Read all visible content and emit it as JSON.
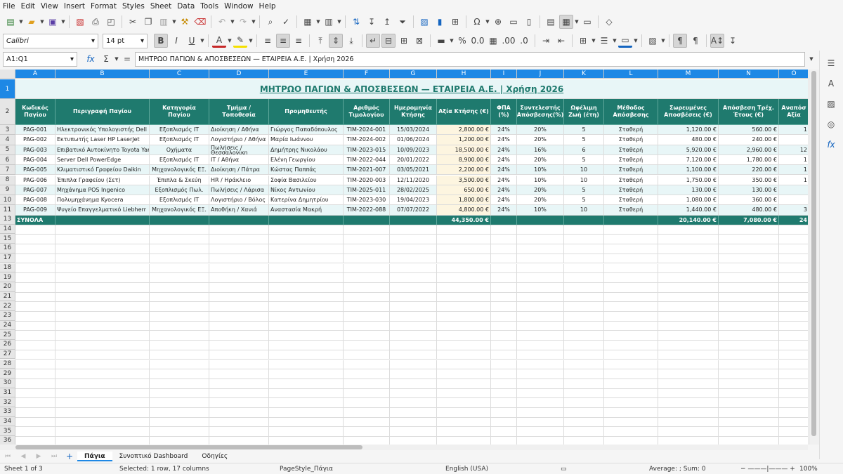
{
  "menu": [
    "File",
    "Edit",
    "View",
    "Insert",
    "Format",
    "Styles",
    "Sheet",
    "Data",
    "Tools",
    "Window",
    "Help"
  ],
  "font": {
    "name": "Calibri",
    "size": "14 pt"
  },
  "namebox": "A1:Q1",
  "formula": "ΜΗΤΡΩΟ ΠΑΓΙΩΝ & ΑΠΟΣΒΕΣΕΩΝ — ΕΤΑΙΡΕΙΑ Α.Ε.  |  Χρήση 2026",
  "title": "ΜΗΤΡΩΟ ΠΑΓΙΩΝ & ΑΠΟΣΒΕΣΕΩΝ — ΕΤΑΙΡΕΙΑ Α.Ε.  |  Χρήση 2026",
  "colletters": [
    "A",
    "B",
    "C",
    "D",
    "E",
    "F",
    "G",
    "H",
    "I",
    "J",
    "K",
    "L",
    "M",
    "N",
    "O"
  ],
  "headers": [
    "Κωδικός Παγίου",
    "Περιγραφή Παγίου",
    "Κατηγορία Παγίου",
    "Τμήμα / Τοποθεσία",
    "Προμηθευτής",
    "Αριθμός Τιμολογίου",
    "Ημερομηνία Κτήσης",
    "Αξία Κτήσης (€)",
    "ΦΠΑ (%)",
    "Συντελεστής Απόσβεσης(%)",
    "Ωφέλιμη Ζωή (έτη)",
    "Μέθοδος Απόσβεσης",
    "Σωρευμένες Αποσβέσεις (€)",
    "Απόσβεση Τρέχ. Έτους (€)",
    "Αναπόσ Αξία"
  ],
  "rows": [
    [
      "PAG-001",
      "Ηλεκτρονικός Υπολογιστής Dell",
      "Εξοπλισμός IT",
      "Διοίκηση / Αθήνα",
      "Γιώργος Παπαδόπουλος",
      "ΤΙΜ-2024-001",
      "15/03/2024",
      "2,800.00 €",
      "24%",
      "20%",
      "5",
      "Σταθερή",
      "1,120.00 €",
      "560.00 €",
      "1"
    ],
    [
      "PAG-002",
      "Εκτυπωτής Laser HP LaserJet",
      "Εξοπλισμός IT",
      "Λογιστήριο / Αθήνα",
      "Μαρία Ιωάννου",
      "ΤΙΜ-2024-002",
      "01/06/2024",
      "1,200.00 €",
      "24%",
      "20%",
      "5",
      "Σταθερή",
      "480.00 €",
      "240.00 €",
      ""
    ],
    [
      "PAG-003",
      "Επιβατικό Αυτοκίνητο Toyota Yaris",
      "Οχήματα",
      "Πωλήσεις / Θεσσαλονίκη",
      "Δημήτρης Νικολάου",
      "ΤΙΜ-2023-015",
      "10/09/2023",
      "18,500.00 €",
      "24%",
      "16%",
      "6",
      "Σταθερή",
      "5,920.00 €",
      "2,960.00 €",
      "12"
    ],
    [
      "PAG-004",
      "Server Dell PowerEdge",
      "Εξοπλισμός IT",
      "IT / Αθήνα",
      "Ελένη Γεωργίου",
      "ΤΙΜ-2022-044",
      "20/01/2022",
      "8,900.00 €",
      "24%",
      "20%",
      "5",
      "Σταθερή",
      "7,120.00 €",
      "1,780.00 €",
      "1"
    ],
    [
      "PAG-005",
      "Κλιματιστικό Γραφείου Daikin",
      "Μηχανολογικός ΕΞ.",
      "Διοίκηση / Πάτρα",
      "Κώστας Παππάς",
      "ΤΙΜ-2021-007",
      "03/05/2021",
      "2,200.00 €",
      "24%",
      "10%",
      "10",
      "Σταθερή",
      "1,100.00 €",
      "220.00 €",
      "1"
    ],
    [
      "PAG-006",
      "Έπιπλα Γραφείου (Σετ)",
      "Έπιπλα & Σκεύη",
      "HR / Ηράκλειο",
      "Σοφία Βασιλείου",
      "ΤΙΜ-2020-003",
      "12/11/2020",
      "3,500.00 €",
      "24%",
      "10%",
      "10",
      "Σταθερή",
      "1,750.00 €",
      "350.00 €",
      "1"
    ],
    [
      "PAG-007",
      "Μηχάνημα POS Ingenico",
      "Εξοπλισμός Πωλ.",
      "Πωλήσεις / Λάρισα",
      "Νίκος Αντωνίου",
      "ΤΙΜ-2025-011",
      "28/02/2025",
      "650.00 €",
      "24%",
      "20%",
      "5",
      "Σταθερή",
      "130.00 €",
      "130.00 €",
      ""
    ],
    [
      "PAG-008",
      "Πολυμηχάνημα Kyocera",
      "Εξοπλισμός IT",
      "Λογιστήριο / Βόλος",
      "Κατερίνα Δημητρίου",
      "ΤΙΜ-2023-030",
      "19/04/2023",
      "1,800.00 €",
      "24%",
      "20%",
      "5",
      "Σταθερή",
      "1,080.00 €",
      "360.00 €",
      ""
    ],
    [
      "PAG-009",
      "Ψυγείο Επαγγελματικό Liebherr",
      "Μηχανολογικός ΕΞ.",
      "Αποθήκη / Χανιά",
      "Αναστασία Μακρή",
      "ΤΙΜ-2022-088",
      "07/07/2022",
      "4,800.00 €",
      "24%",
      "10%",
      "10",
      "Σταθερή",
      "1,440.00 €",
      "480.00 €",
      "3"
    ]
  ],
  "totals": {
    "label": "ΣΥΝΟΛΑ",
    "acquisition": "44,350.00 €",
    "accumulated": "20,140.00 €",
    "current": "7,080.00 €",
    "residual": "24"
  },
  "tabs": [
    "Πάγια",
    "Συνοπτικό Dashboard",
    "Οδηγίες"
  ],
  "status": {
    "sheet": "Sheet 1 of 3",
    "selection": "Selected: 1 row, 17 columns",
    "pagestyle": "PageStyle_Πάγια",
    "language": "English (USA)",
    "sum": "Average: ; Sum: 0",
    "zoom": "100%"
  }
}
